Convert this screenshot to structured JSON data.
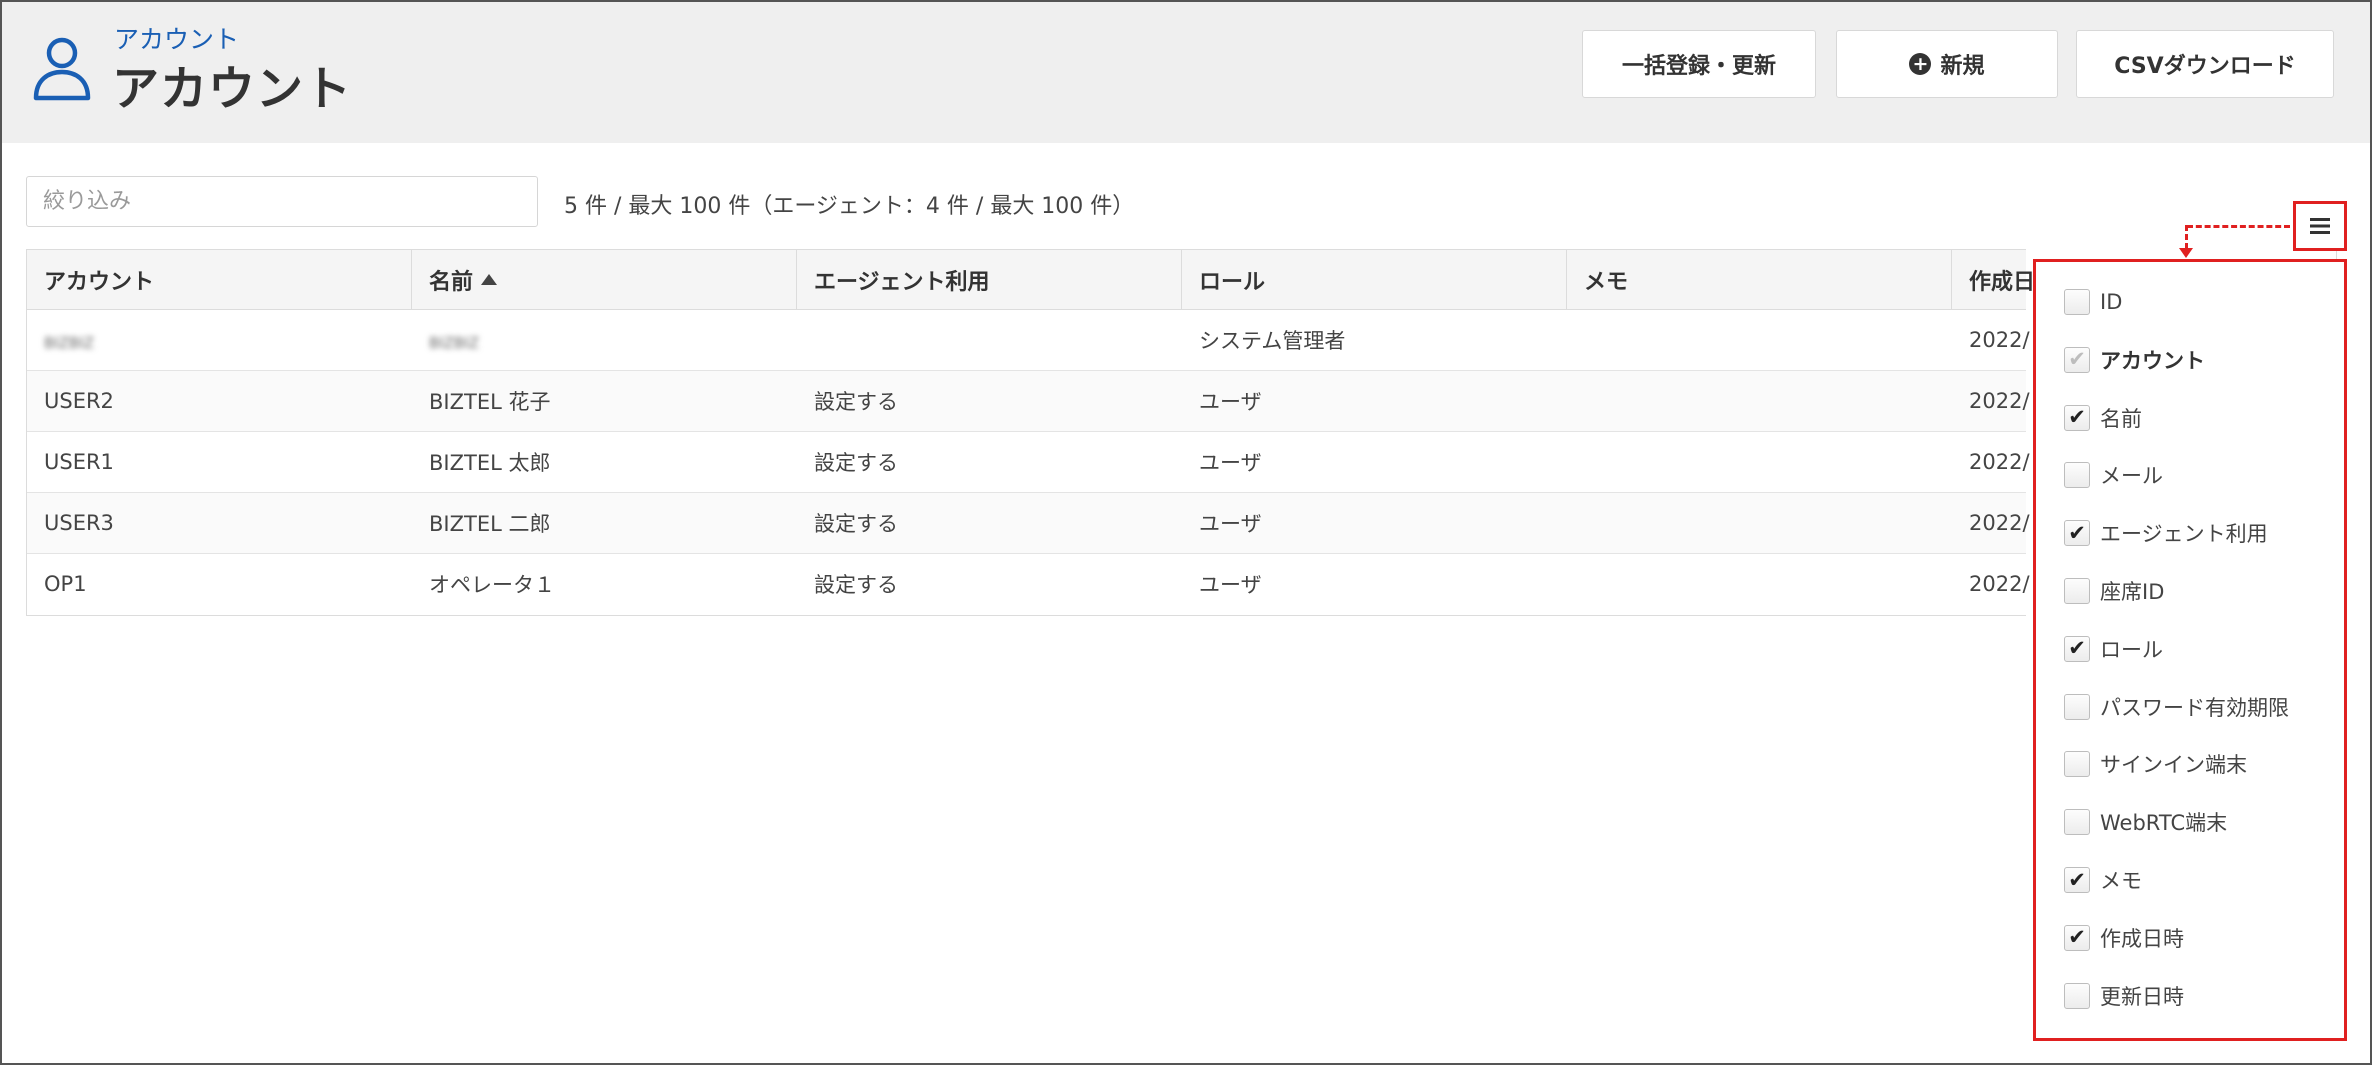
{
  "header": {
    "breadcrumb": "アカウント",
    "title": "アカウント",
    "buttons": {
      "bulk": "一括登録・更新",
      "new": "新規",
      "csv": "CSVダウンロード"
    },
    "icons": {
      "page": "user-icon",
      "new": "plus-circle-icon"
    }
  },
  "filter": {
    "placeholder": "絞り込み",
    "count_text": "5 件 / 最大 100 件（エージェント：4 件 / 最大 100 件）"
  },
  "table": {
    "columns": [
      "アカウント",
      "名前",
      "エージェント利用",
      "ロール",
      "メモ",
      "作成日"
    ],
    "sorted_column": "名前",
    "sort_direction": "asc",
    "rows": [
      {
        "account": "BIZBIZ",
        "name": "BIZBIZ",
        "agent": "",
        "role": "システム管理者",
        "memo": "",
        "created": "2022/"
      },
      {
        "account": "USER2",
        "name": "BIZTEL 花子",
        "agent": "設定する",
        "role": "ユーザ",
        "memo": "",
        "created": "2022/"
      },
      {
        "account": "USER1",
        "name": "BIZTEL 太郎",
        "agent": "設定する",
        "role": "ユーザ",
        "memo": "",
        "created": "2022/"
      },
      {
        "account": "USER3",
        "name": "BIZTEL 二郎",
        "agent": "設定する",
        "role": "ユーザ",
        "memo": "",
        "created": "2022/"
      },
      {
        "account": "OP1",
        "name": "オペレータ１",
        "agent": "設定する",
        "role": "ユーザ",
        "memo": "",
        "created": "2022/"
      }
    ]
  },
  "column_menu": {
    "toggle_icon": "hamburger-icon",
    "highlight_color": "#e02020",
    "items": [
      {
        "label": "ID",
        "checked": false,
        "disabled": false
      },
      {
        "label": "アカウント",
        "checked": true,
        "disabled": true
      },
      {
        "label": "名前",
        "checked": true,
        "disabled": false
      },
      {
        "label": "メール",
        "checked": false,
        "disabled": false
      },
      {
        "label": "エージェント利用",
        "checked": true,
        "disabled": false
      },
      {
        "label": "座席ID",
        "checked": false,
        "disabled": false
      },
      {
        "label": "ロール",
        "checked": true,
        "disabled": false
      },
      {
        "label": "パスワード有効期限",
        "checked": false,
        "disabled": false
      },
      {
        "label": "サインイン端末",
        "checked": false,
        "disabled": false
      },
      {
        "label": "WebRTC端末",
        "checked": false,
        "disabled": false
      },
      {
        "label": "メモ",
        "checked": true,
        "disabled": false
      },
      {
        "label": "作成日時",
        "checked": true,
        "disabled": false
      },
      {
        "label": "更新日時",
        "checked": false,
        "disabled": false
      }
    ]
  },
  "colors": {
    "accent": "#1a5fb4",
    "header_bg": "#efefef"
  }
}
